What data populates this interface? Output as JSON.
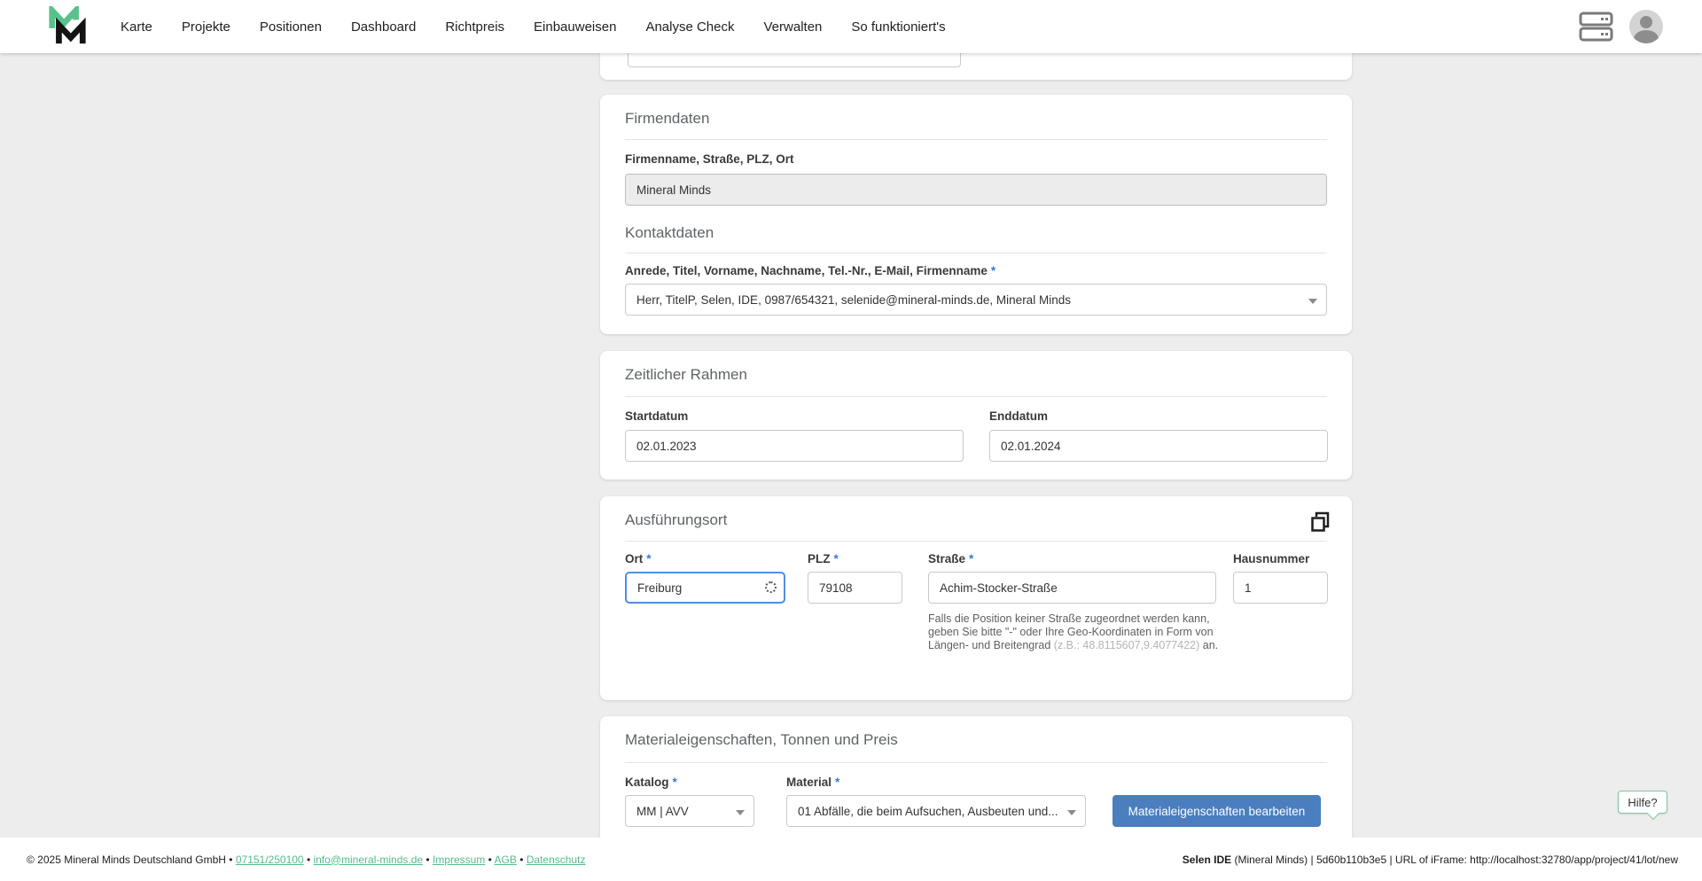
{
  "nav": {
    "items": [
      "Karte",
      "Projekte",
      "Positionen",
      "Dashboard",
      "Richtpreis",
      "Einbauweisen",
      "Analyse Check",
      "Verwalten",
      "So funktioniert's"
    ],
    "right_icons": [
      "server-icon",
      "user-avatar"
    ]
  },
  "misc": {
    "required_mark": "*"
  },
  "cards": {
    "firmendaten": {
      "title": "Firmendaten",
      "field_label": "Firmenname, Straße, PLZ, Ort",
      "field_value": "Mineral Minds"
    },
    "kontaktdaten": {
      "title": "Kontaktdaten",
      "field_label": "Anrede, Titel, Vorname, Nachname, Tel.-Nr., E-Mail, Firmenname",
      "field_value": "Herr, TitelP, Selen, IDE, 0987/654321, selenide@mineral-minds.de, Mineral Minds"
    },
    "zeitlicher_rahmen": {
      "title": "Zeitlicher Rahmen",
      "startdatum_label": "Startdatum",
      "startdatum_value": "02.01.2023",
      "enddatum_label": "Enddatum",
      "enddatum_value": "02.01.2024"
    },
    "ausfuehrungsort": {
      "title": "Ausführungsort",
      "ort_label": "Ort",
      "ort_value": "Freiburg",
      "plz_label": "PLZ",
      "plz_value": "79108",
      "strasse_label": "Straße",
      "strasse_value": "Achim-Stocker-Straße",
      "hausnummer_label": "Hausnummer",
      "hausnummer_value": "1",
      "strasse_help_1": "Falls die Position keiner Straße zugeordnet werden kann, geben Sie bitte \"-\" oder Ihre Geo-Koordinaten in Form von Längen- und Breitengrad ",
      "strasse_help_example": "(z.B.: 48.8115607,9.4077422)",
      "strasse_help_2": " an."
    },
    "material": {
      "title": "Materialeigenschaften, Tonnen und Preis",
      "katalog_label": "Katalog",
      "katalog_value": "MM | AVV",
      "material_label": "Material",
      "material_value": "01 Abfälle, die beim Aufsuchen, Ausbeuten und...",
      "edit_button": "Materialeigenschaften bearbeiten"
    }
  },
  "help_bubble": {
    "label": "Hilfe?"
  },
  "footer": {
    "copyright": "© 2025 Mineral Minds Deutschland GmbH",
    "separator": "•",
    "phone_link": "07151/250100",
    "email_link": "info@mineral-minds.de",
    "impressum_link": "Impressum",
    "agb_link": "AGB",
    "datenschutz_link": "Datenschutz",
    "right_bold": "Selen IDE",
    "right_rest": " (Mineral Minds) | 5d60b110b3e5 | URL of iFrame: http://localhost:32780/app/project/41/lot/new"
  },
  "colors": {
    "accent_green": "#52bd8a",
    "accent_blue": "#3878d4",
    "button_blue": "#4a7ebf"
  }
}
